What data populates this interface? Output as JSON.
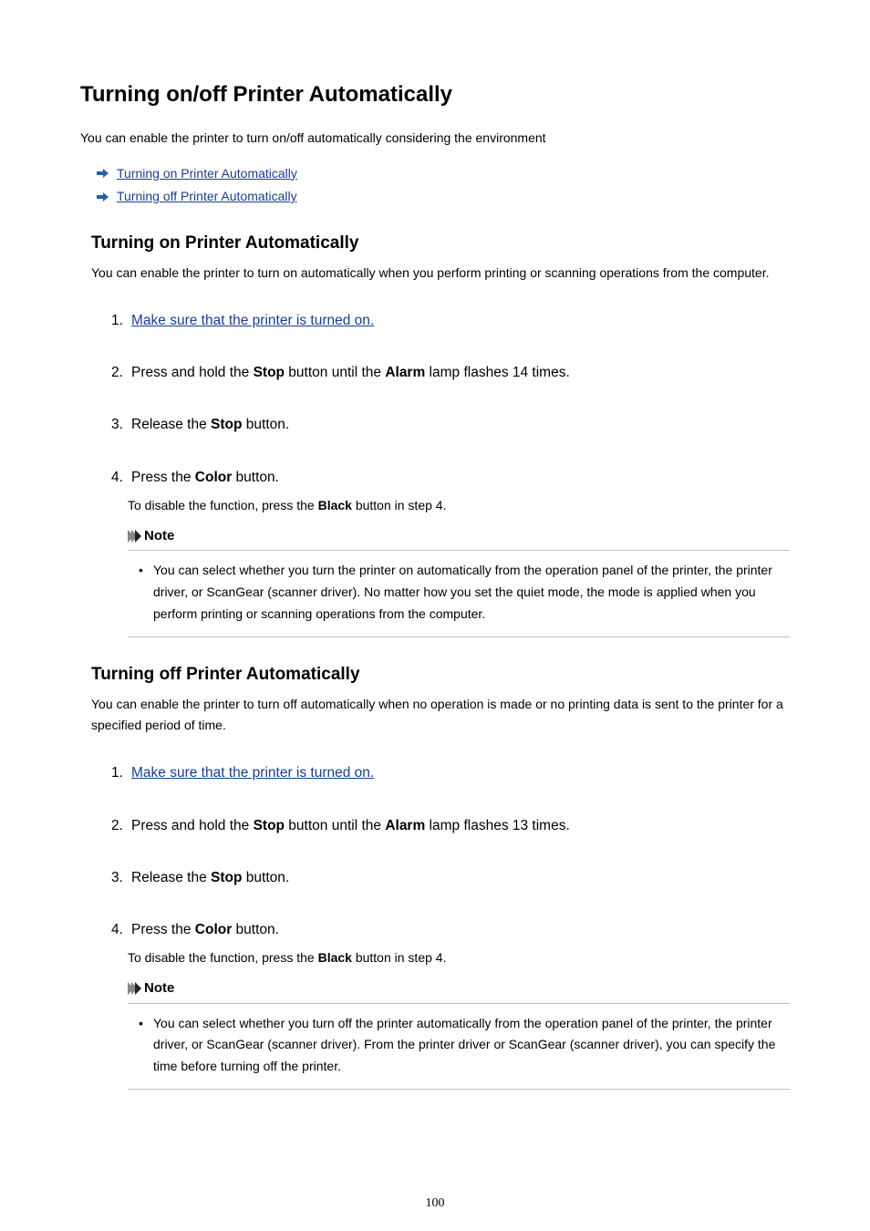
{
  "title": "Turning on/off Printer Automatically",
  "intro": "You can enable the printer to turn on/off automatically considering the environment",
  "toc": {
    "on": "Turning on Printer Automatically",
    "off": "Turning off Printer Automatically"
  },
  "section_on": {
    "heading": "Turning on Printer Automatically",
    "desc": "You can enable the printer to turn on automatically when you perform printing or scanning operations from the computer.",
    "steps": {
      "s1": {
        "num": "1.",
        "link": "Make sure that the printer is turned on."
      },
      "s2": {
        "num": "2.",
        "pre": "Press and hold the ",
        "b1": "Stop",
        "mid": " button until the ",
        "b2": "Alarm",
        "post": " lamp flashes 14 times."
      },
      "s3": {
        "num": "3.",
        "pre": "Release the ",
        "b1": "Stop",
        "post": " button."
      },
      "s4": {
        "num": "4.",
        "pre": "Press the ",
        "b1": "Color",
        "post": " button.",
        "sub_pre": "To disable the function, press the ",
        "sub_b": "Black",
        "sub_post": " button in step 4."
      }
    },
    "note_label": "Note",
    "note_text": "You can select whether you turn the printer on automatically from the operation panel of the printer, the printer driver, or ScanGear (scanner driver). No matter how you set the quiet mode, the mode is applied when you perform printing or scanning operations from the computer."
  },
  "section_off": {
    "heading": "Turning off Printer Automatically",
    "desc": "You can enable the printer to turn off automatically when no operation is made or no printing data is sent to the printer for a specified period of time.",
    "steps": {
      "s1": {
        "num": "1.",
        "link": "Make sure that the printer is turned on."
      },
      "s2": {
        "num": "2.",
        "pre": "Press and hold the ",
        "b1": "Stop",
        "mid": " button until the ",
        "b2": "Alarm",
        "post": " lamp flashes 13 times."
      },
      "s3": {
        "num": "3.",
        "pre": "Release the ",
        "b1": "Stop",
        "post": " button."
      },
      "s4": {
        "num": "4.",
        "pre": "Press the ",
        "b1": "Color",
        "post": " button.",
        "sub_pre": "To disable the function, press the ",
        "sub_b": "Black",
        "sub_post": " button in step 4."
      }
    },
    "note_label": "Note",
    "note_text": "You can select whether you turn off the printer automatically from the operation panel of the printer, the printer driver, or ScanGear (scanner driver). From the printer driver or ScanGear (scanner driver), you can specify the time before turning off the printer."
  },
  "page_number": "100"
}
